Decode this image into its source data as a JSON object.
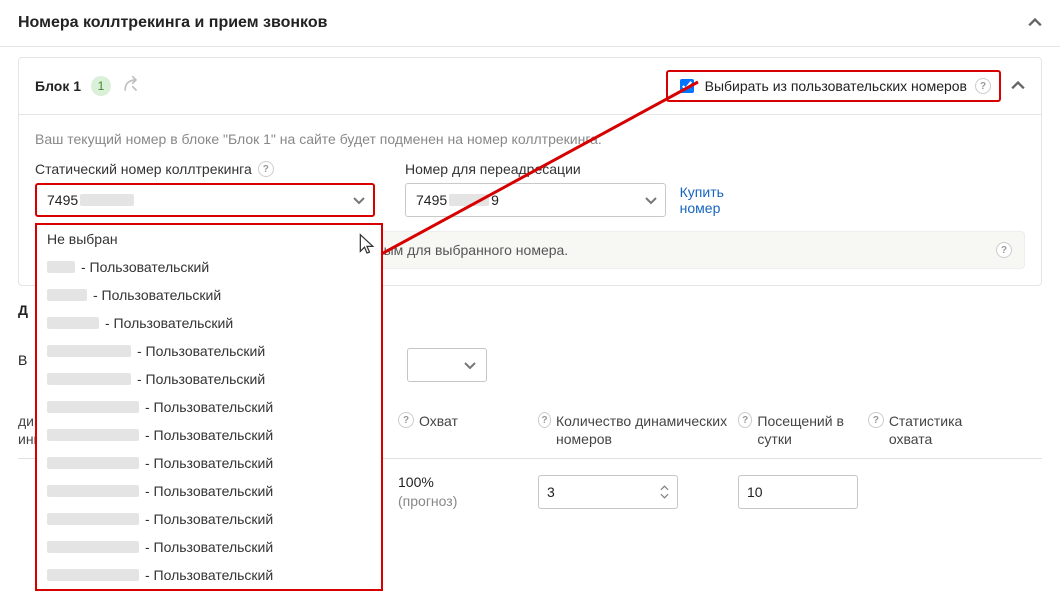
{
  "header": {
    "title": "Номера коллтрекинга и прием звонков"
  },
  "block": {
    "title": "Блок 1",
    "badge": "1",
    "checkbox_label": "Выбирать из пользовательских номеров",
    "subtext": "Ваш текущий номер в блоке \"Блок 1\" на сайте будет подменен на номер коллтрекинга."
  },
  "fields": {
    "static_label": "Статический номер коллтрекинга",
    "static_value": "7495",
    "forward_label": "Номер для переадресации",
    "forward_prefix": "7495",
    "forward_suffix": "9",
    "buy_link": "Купить номер"
  },
  "note": "Звонки будут приниматься по правилам, настроенным для выбранного номера.",
  "dropdown": {
    "not_selected": "Не выбран",
    "suffix": " - Пользовательский"
  },
  "under": {
    "d_prefix": "Д",
    "v_prefix": "В"
  },
  "table": {
    "col1a": "динамическим",
    "col1b": "ингом",
    "col2": "Охват",
    "col3": "Количество динамических номеров",
    "col4": "Посещений в сутки",
    "col5": "Статистика охвата",
    "row": {
      "coverage_val": "100%",
      "coverage_sub": "(прогноз)",
      "dyn_count": "3",
      "visits": "10"
    }
  }
}
